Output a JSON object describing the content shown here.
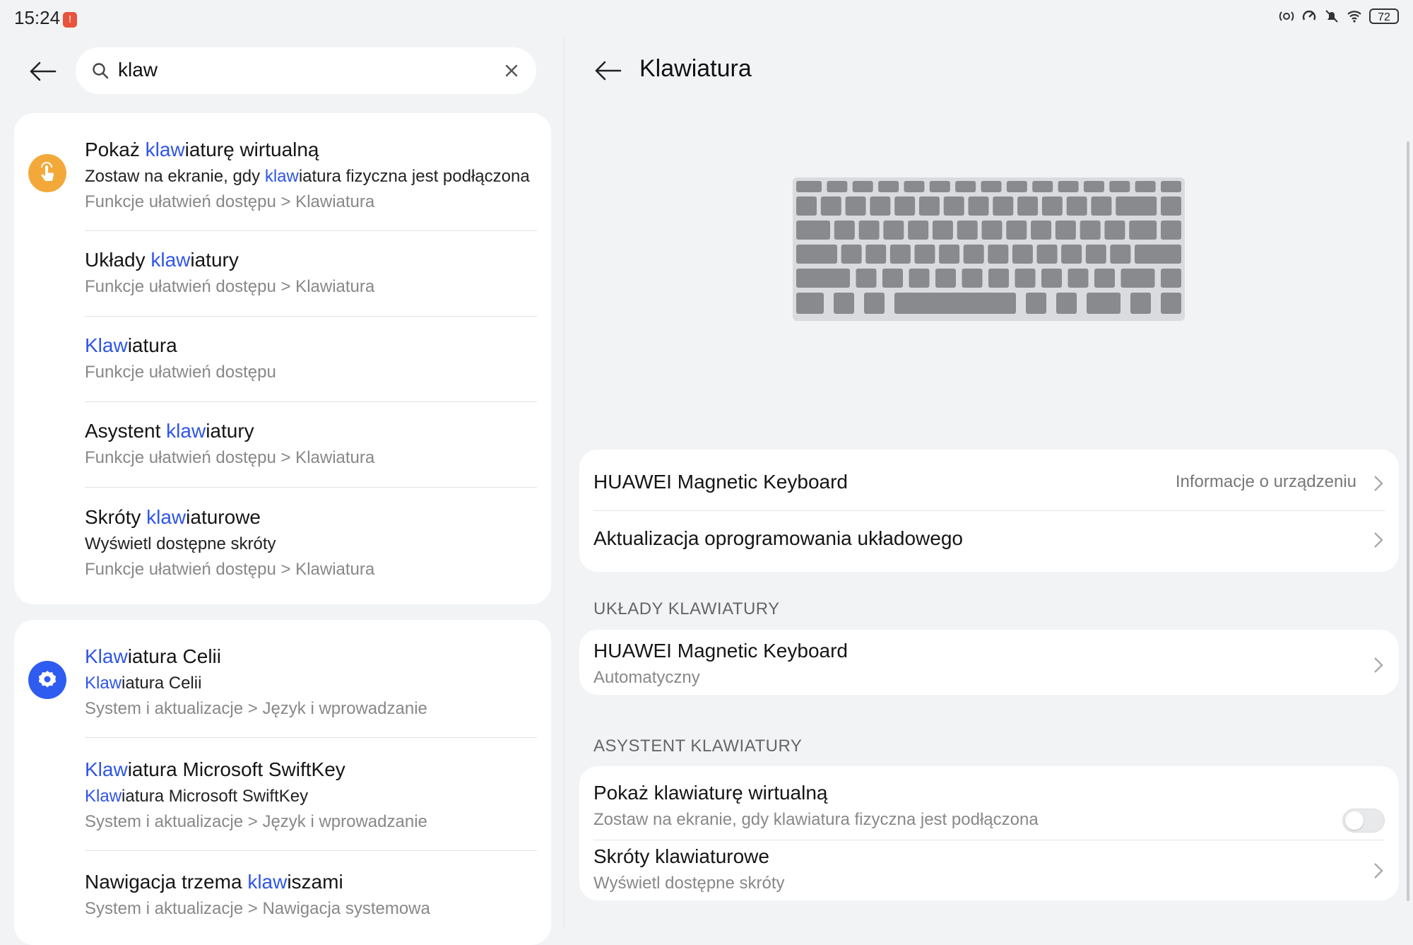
{
  "status_bar": {
    "time": "15:24",
    "notification_badge": "!",
    "battery": "72",
    "icons": [
      "nfc-icon",
      "data-saver-icon",
      "mute-icon",
      "wifi-icon",
      "battery-icon"
    ]
  },
  "search": {
    "query": "klaw"
  },
  "results_group_1": {
    "icon": "accessibility-touch-icon",
    "icon_color": "#f3a93a",
    "items": [
      {
        "title_pre": "Pokaż ",
        "title_hl": "klaw",
        "title_post": "iaturę wirtualną",
        "sub_pre": "Zostaw na ekranie, gdy ",
        "sub_hl": "klaw",
        "sub_post": "iatura fizyczna jest podłączona",
        "path": "Funkcje ułatwień dostępu > Klawiatura"
      },
      {
        "title_pre": "Układy ",
        "title_hl": "klaw",
        "title_post": "iatury",
        "path": "Funkcje ułatwień dostępu > Klawiatura"
      },
      {
        "title_pre": "",
        "title_hl": "Klaw",
        "title_post": "iatura",
        "path": "Funkcje ułatwień dostępu"
      },
      {
        "title_pre": "Asystent ",
        "title_hl": "klaw",
        "title_post": "iatury",
        "path": "Funkcje ułatwień dostępu > Klawiatura"
      },
      {
        "title_pre": "Skróty ",
        "title_hl": "klaw",
        "title_post": "iaturowe",
        "sub": "Wyświetl dostępne skróty",
        "path": "Funkcje ułatwień dostępu > Klawiatura"
      }
    ]
  },
  "results_group_2": {
    "icon": "settings-gear-icon",
    "icon_color": "#2f5cf0",
    "items": [
      {
        "title_pre": "",
        "title_hl": "Klaw",
        "title_post": "iatura Celii",
        "sub_pre": "",
        "sub_hl": "Klaw",
        "sub_post": "iatura Celii",
        "path": "System i aktualizacje > Język i wprowadzanie"
      },
      {
        "title_pre": "",
        "title_hl": "Klaw",
        "title_post": "iatura Microsoft SwiftKey",
        "sub_pre": "",
        "sub_hl": "Klaw",
        "sub_post": "iatura Microsoft SwiftKey",
        "path": "System i aktualizacje > Język i wprowadzanie"
      },
      {
        "title_pre": "Nawigacja trzema ",
        "title_hl": "klaw",
        "title_post": "iszami",
        "path": "System i aktualizacje > Nawigacja systemowa"
      }
    ]
  },
  "detail": {
    "title": "Klawiatura",
    "illustration": "keyboard-illustration",
    "device_card": {
      "device_name": "HUAWEI Magnetic Keyboard",
      "device_info": "Informacje o urządzeniu",
      "firmware": "Aktualizacja oprogramowania układowego"
    },
    "layouts_header": "UKŁADY KLAWIATURY",
    "layouts_card": {
      "name": "HUAWEI Magnetic Keyboard",
      "value": "Automatyczny"
    },
    "assistant_header": "ASYSTENT KLAWIATURY",
    "assistant_card": {
      "virtual_title": "Pokaż klawiaturę wirtualną",
      "virtual_sub": "Zostaw na ekranie, gdy klawiatura fizyczna jest podłączona",
      "virtual_enabled": false,
      "shortcuts_title": "Skróty klawiaturowe",
      "shortcuts_sub": "Wyświetl dostępne skróty"
    }
  }
}
